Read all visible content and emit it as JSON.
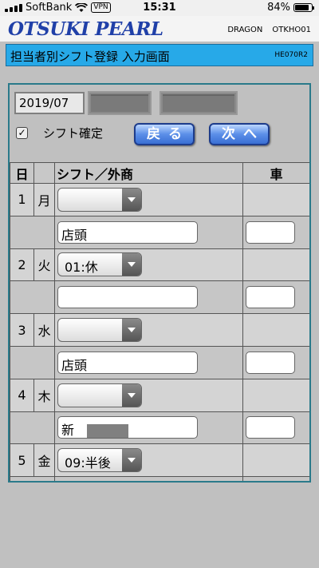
{
  "status_bar": {
    "carrier": "SoftBank",
    "vpn": "VPN",
    "time": "15:31",
    "battery": "84%",
    "battery_level": 0.84
  },
  "header": {
    "logo": "OTSUKI PEARL",
    "server": "DRAGON",
    "user": "OTKHO01"
  },
  "title_bar": {
    "title": "担当者別シフト登録 入力画面",
    "screen_code": "HE070R2"
  },
  "form": {
    "month": "2019/07",
    "confirm_label": "シフト確定",
    "confirm_checked": true,
    "back_label": "戻る",
    "next_label": "次へ"
  },
  "table": {
    "headers": {
      "day": "日",
      "shift": "シフト／外商",
      "car": "車"
    },
    "rows": [
      {
        "day": "1",
        "weekday": "月",
        "shift": "",
        "store": "店頭"
      },
      {
        "day": "2",
        "weekday": "火",
        "shift": "01:休",
        "store": ""
      },
      {
        "day": "3",
        "weekday": "水",
        "shift": "",
        "store": "店頭"
      },
      {
        "day": "4",
        "weekday": "木",
        "shift": "",
        "store": "新"
      },
      {
        "day": "5",
        "weekday": "金",
        "shift": "09:半後",
        "store": ""
      }
    ]
  },
  "colors": {
    "title_bar": "#27a9e8",
    "logo": "#2040a8",
    "button": "#3a6fd4"
  }
}
